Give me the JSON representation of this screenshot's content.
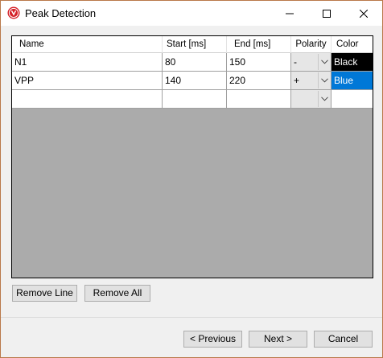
{
  "window": {
    "title": "Peak Detection"
  },
  "grid": {
    "columns": [
      "Name",
      "Start [ms]",
      "End [ms]",
      "Polarity",
      "Color"
    ],
    "rows": [
      {
        "name": "N1",
        "start": "80",
        "end": "150",
        "polarity": "-",
        "color": "Black"
      },
      {
        "name": "VPP",
        "start": "140",
        "end": "220",
        "polarity": "+",
        "color": "Blue"
      },
      {
        "name": "",
        "start": "",
        "end": "",
        "polarity": "",
        "color": ""
      }
    ]
  },
  "buttons": {
    "remove_line": "Remove Line",
    "remove_all": "Remove All",
    "previous": "< Previous",
    "next": "Next >",
    "cancel": "Cancel"
  },
  "colors": {
    "black_swatch": "#000000",
    "blue_swatch": "#0078d7",
    "grid_background": "#ababab",
    "window_border": "#b9794a"
  },
  "icons": {
    "app": "app-logo-icon",
    "minimize": "minimize-icon",
    "maximize": "maximize-icon",
    "close": "close-icon",
    "dropdown": "chevron-down-icon"
  }
}
